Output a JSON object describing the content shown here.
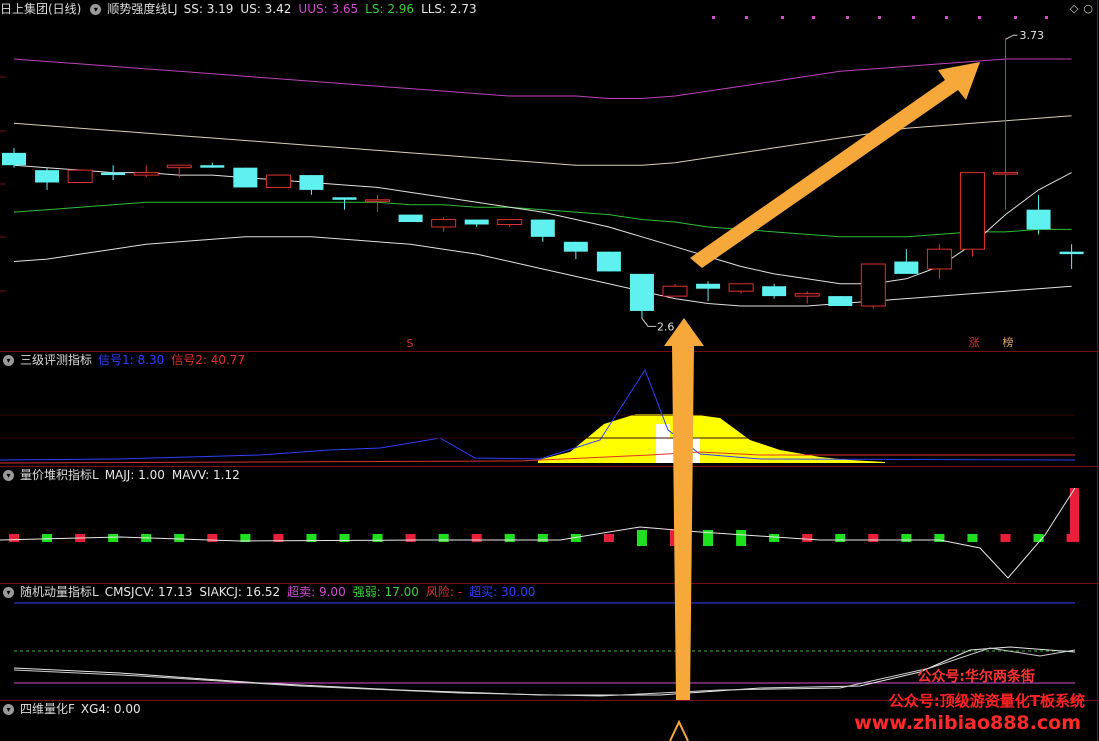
{
  "main": {
    "stock": "日上集团(日线)",
    "indicator": "顺势强度线LJ",
    "values": [
      {
        "label": "SS: 3.19",
        "color": "#e8e8e8"
      },
      {
        "label": "US: 3.42",
        "color": "#e8e8e8"
      },
      {
        "label": "UUS: 3.65",
        "color": "#d24bd2"
      },
      {
        "label": "LS: 2.96",
        "color": "#3ccf3c"
      },
      {
        "label": "LLS: 2.73",
        "color": "#e8e8e8"
      }
    ],
    "high_label": "3.73",
    "low_label": "2.6",
    "s_marker": "S",
    "tags": [
      "涨",
      "榜"
    ]
  },
  "panel2": {
    "title": "三级评测指标",
    "values": [
      {
        "label": "信号1: 8.30",
        "color": "#2f3fff"
      },
      {
        "label": "信号2: 40.77",
        "color": "#e03030"
      }
    ]
  },
  "panel3": {
    "title": "量价堆积指标L",
    "values": [
      {
        "label": "MAJJ: 1.00",
        "color": "#e8e8e8"
      },
      {
        "label": "MAVV: 1.12",
        "color": "#e8e8e8"
      }
    ]
  },
  "panel4": {
    "title": "随机动量指标L",
    "values": [
      {
        "label": "CMSJCV: 17.13",
        "color": "#e8e8e8"
      },
      {
        "label": "SIAKCJ: 16.52",
        "color": "#e8e8e8"
      },
      {
        "label": "超卖: 9.00",
        "color": "#d24bd2"
      },
      {
        "label": "强弱: 17.00",
        "color": "#3ccf3c"
      },
      {
        "label": "风险: -",
        "color": "#e03030"
      },
      {
        "label": "超买: 30.00",
        "color": "#2f3fff"
      }
    ]
  },
  "panel5": {
    "title": "四维量化F",
    "values": [
      {
        "label": "XG4: 0.00",
        "color": "#e8e8e8"
      }
    ]
  },
  "watermark": {
    "line1": "公众号:华尔两条街",
    "line2": "公众号:顶级游资量化T板系统",
    "line3": "www.zhibiao888.com"
  },
  "colors": {
    "up": "#e03030",
    "down": "#5ff0f0",
    "yellow": "#ffff00",
    "panel_border": "#7a0e0e",
    "arrow": "#f7a83a"
  },
  "chart_data": {
    "type": "candlestick",
    "price_labels": {
      "high": 3.73,
      "low": 2.6
    },
    "candles": [
      {
        "o": 3.27,
        "c": 3.22,
        "h": 3.29,
        "l": 3.21
      },
      {
        "o": 3.2,
        "c": 3.15,
        "h": 3.21,
        "l": 3.12
      },
      {
        "o": 3.15,
        "c": 3.2,
        "h": 3.2,
        "l": 3.15
      },
      {
        "o": 3.19,
        "c": 3.18,
        "h": 3.22,
        "l": 3.16
      },
      {
        "o": 3.18,
        "c": 3.19,
        "h": 3.22,
        "l": 3.17
      },
      {
        "o": 3.21,
        "c": 3.22,
        "h": 3.22,
        "l": 3.17
      },
      {
        "o": 3.22,
        "c": 3.21,
        "h": 3.23,
        "l": 3.21
      },
      {
        "o": 3.21,
        "c": 3.13,
        "h": 3.21,
        "l": 3.13
      },
      {
        "o": 3.13,
        "c": 3.18,
        "h": 3.18,
        "l": 3.13
      },
      {
        "o": 3.18,
        "c": 3.12,
        "h": 3.18,
        "l": 3.1
      },
      {
        "o": 3.09,
        "c": 3.08,
        "h": 3.09,
        "l": 3.04
      },
      {
        "o": 3.08,
        "c": 3.08,
        "h": 3.1,
        "l": 3.03
      },
      {
        "o": 3.02,
        "c": 2.99,
        "h": 3.02,
        "l": 2.99
      },
      {
        "o": 2.97,
        "c": 3.0,
        "h": 3.01,
        "l": 2.95
      },
      {
        "o": 3.0,
        "c": 2.98,
        "h": 3.0,
        "l": 2.97
      },
      {
        "o": 2.98,
        "c": 3.0,
        "h": 3.0,
        "l": 2.97
      },
      {
        "o": 3.0,
        "c": 2.93,
        "h": 3.0,
        "l": 2.91
      },
      {
        "o": 2.91,
        "c": 2.87,
        "h": 2.91,
        "l": 2.84
      },
      {
        "o": 2.87,
        "c": 2.79,
        "h": 2.87,
        "l": 2.79
      },
      {
        "o": 2.78,
        "c": 2.63,
        "h": 2.78,
        "l": 2.6
      },
      {
        "o": 2.69,
        "c": 2.73,
        "h": 2.74,
        "l": 2.69
      },
      {
        "o": 2.74,
        "c": 2.72,
        "h": 2.75,
        "l": 2.67
      },
      {
        "o": 2.71,
        "c": 2.74,
        "h": 2.74,
        "l": 2.7
      },
      {
        "o": 2.73,
        "c": 2.69,
        "h": 2.74,
        "l": 2.68
      },
      {
        "o": 2.69,
        "c": 2.7,
        "h": 2.71,
        "l": 2.66
      },
      {
        "o": 2.69,
        "c": 2.65,
        "h": 2.69,
        "l": 2.65
      },
      {
        "o": 2.65,
        "c": 2.82,
        "h": 2.82,
        "l": 2.64
      },
      {
        "o": 2.83,
        "c": 2.78,
        "h": 2.88,
        "l": 2.78
      },
      {
        "o": 2.8,
        "c": 2.88,
        "h": 2.9,
        "l": 2.76
      },
      {
        "o": 2.88,
        "c": 3.19,
        "h": 3.19,
        "l": 2.85
      },
      {
        "o": 3.19,
        "c": 3.19,
        "h": 3.73,
        "l": 3.04
      },
      {
        "o": 3.04,
        "c": 2.96,
        "h": 3.1,
        "l": 2.94
      },
      {
        "o": 2.87,
        "c": 2.86,
        "h": 2.9,
        "l": 2.8
      }
    ],
    "uus": [
      3.65,
      3.64,
      3.63,
      3.62,
      3.61,
      3.6,
      3.59,
      3.58,
      3.57,
      3.56,
      3.55,
      3.54,
      3.53,
      3.52,
      3.51,
      3.5,
      3.5,
      3.5,
      3.49,
      3.49,
      3.5,
      3.52,
      3.54,
      3.56,
      3.58,
      3.6,
      3.61,
      3.62,
      3.63,
      3.64,
      3.65,
      3.65,
      3.65
    ],
    "us": [
      3.39,
      3.38,
      3.37,
      3.36,
      3.35,
      3.34,
      3.33,
      3.32,
      3.31,
      3.3,
      3.29,
      3.28,
      3.27,
      3.26,
      3.25,
      3.24,
      3.23,
      3.22,
      3.22,
      3.22,
      3.23,
      3.25,
      3.27,
      3.29,
      3.31,
      3.33,
      3.35,
      3.37,
      3.38,
      3.39,
      3.4,
      3.41,
      3.42
    ],
    "ls": [
      3.03,
      3.04,
      3.05,
      3.06,
      3.07,
      3.07,
      3.07,
      3.07,
      3.07,
      3.07,
      3.07,
      3.07,
      3.06,
      3.06,
      3.05,
      3.05,
      3.04,
      3.03,
      3.02,
      3.0,
      2.99,
      2.97,
      2.96,
      2.95,
      2.94,
      2.93,
      2.93,
      2.93,
      2.94,
      2.95,
      2.95,
      2.96,
      2.96
    ],
    "ss": [
      3.22,
      3.21,
      3.2,
      3.19,
      3.19,
      3.18,
      3.18,
      3.17,
      3.16,
      3.15,
      3.14,
      3.13,
      3.11,
      3.09,
      3.07,
      3.05,
      3.03,
      3.0,
      2.97,
      2.93,
      2.89,
      2.85,
      2.81,
      2.78,
      2.76,
      2.74,
      2.74,
      2.76,
      2.81,
      2.9,
      3.02,
      3.12,
      3.19
    ],
    "lls": [
      2.83,
      2.84,
      2.86,
      2.88,
      2.9,
      2.91,
      2.92,
      2.93,
      2.93,
      2.93,
      2.92,
      2.91,
      2.9,
      2.88,
      2.86,
      2.83,
      2.8,
      2.77,
      2.74,
      2.71,
      2.68,
      2.66,
      2.65,
      2.65,
      2.65,
      2.66,
      2.67,
      2.68,
      2.69,
      2.7,
      2.71,
      2.72,
      2.73
    ]
  }
}
